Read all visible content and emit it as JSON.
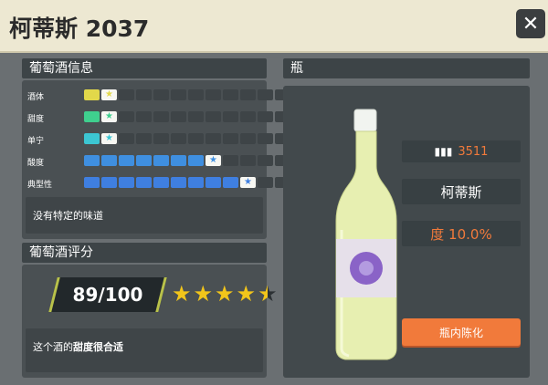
{
  "title": "柯蒂斯 2037",
  "close_icon": "close-icon",
  "wine_info": {
    "header": "葡萄酒信息",
    "attributes": [
      {
        "label": "酒体",
        "level": 2,
        "color": "#e2d84a"
      },
      {
        "label": "甜度",
        "level": 2,
        "color": "#3fcf8e"
      },
      {
        "label": "单宁",
        "level": 2,
        "color": "#3cc6d3"
      },
      {
        "label": "酸度",
        "level": 8,
        "color": "#3f8fe0"
      },
      {
        "label": "典型性",
        "level": 10,
        "color": "#3f7fe0"
      }
    ],
    "max_level": 12,
    "description": "没有特定的味道"
  },
  "rating": {
    "header": "葡萄酒评分",
    "score": "89/100",
    "stars": 4.5,
    "comment_prefix": "这个酒的",
    "comment_bold": "甜度很合适"
  },
  "bottle": {
    "header": "瓶",
    "count_icon": "bottles-icon",
    "count": "3511",
    "name": "柯蒂斯",
    "alcohol": "度 10.0%",
    "aging_button": "瓶内陈化",
    "colors": {
      "count": "#f17a3b",
      "alcohol": "#f17a3b",
      "button": "#f17a3b"
    }
  }
}
